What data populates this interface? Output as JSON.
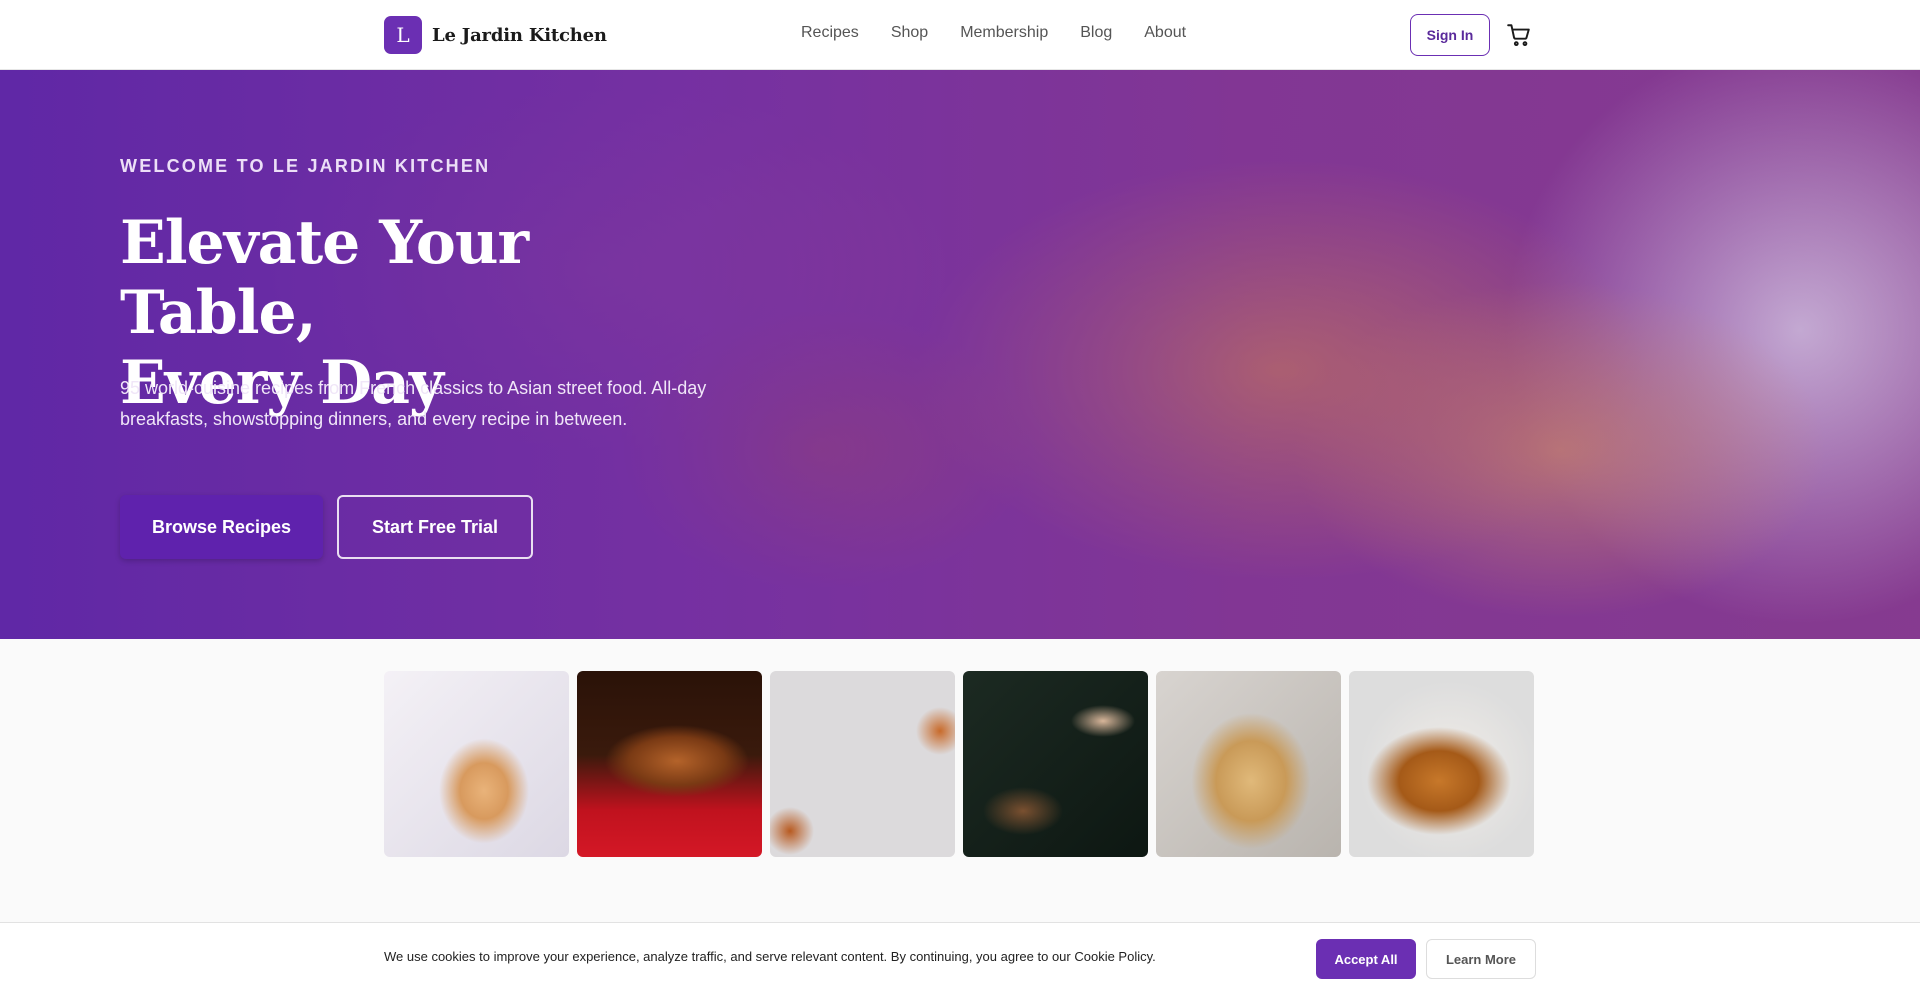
{
  "brand": {
    "logo_letter": "L",
    "name": "Le Jardin Kitchen",
    "accent": "#6b2fb3"
  },
  "nav": {
    "items": [
      "Recipes",
      "Shop",
      "Membership",
      "Blog",
      "About"
    ]
  },
  "header": {
    "signin_label": "Sign In",
    "cart_icon": "shopping-cart-icon"
  },
  "hero": {
    "eyebrow": "WELCOME TO LE JARDIN KITCHEN",
    "title_line1": "Elevate Your Table,",
    "title_line2": "Every Day",
    "description": "95 world-cuisine recipes from French classics to Asian street food. All-day breakfasts, showstopping dinners, and every recipe in between.",
    "primary_cta": "Browse Recipes",
    "secondary_cta": "Start Free Trial"
  },
  "gallery": {
    "tiles": [
      "pancakes",
      "salmon",
      "salads",
      "noodles",
      "spaghetti",
      "roast-chicken"
    ]
  },
  "cookie": {
    "message": "We use cookies to improve your experience, analyze traffic, and serve relevant content. By continuing, you agree to our Cookie Policy.",
    "accept_label": "Accept All",
    "learn_label": "Learn More"
  }
}
